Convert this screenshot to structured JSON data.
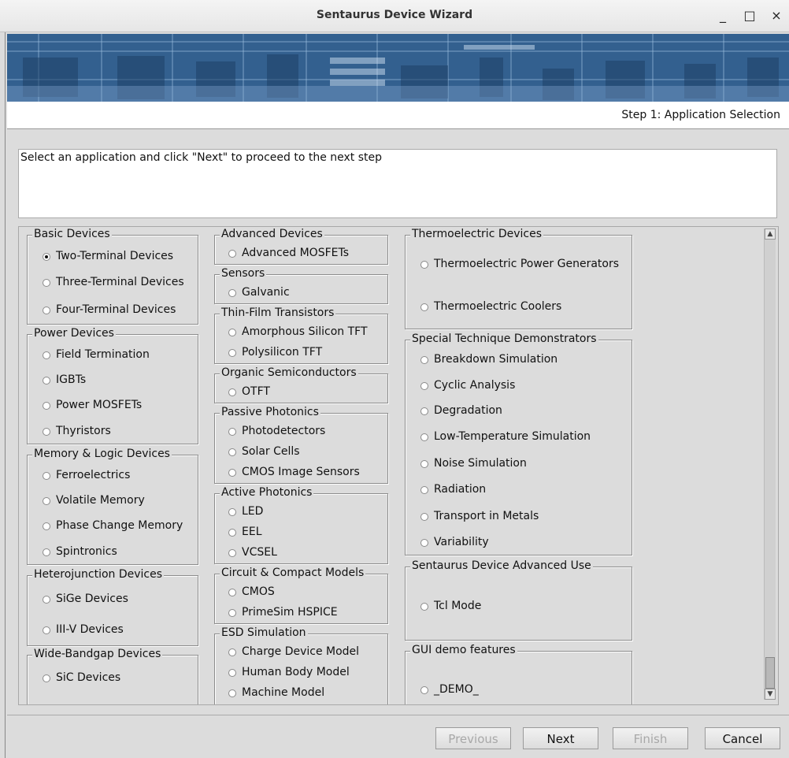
{
  "window": {
    "title": "Sentaurus Device Wizard",
    "minimize": "_",
    "maximize": "□",
    "close": "×"
  },
  "step_label": "Step 1: Application Selection",
  "instruction": "Select an application and click \"Next\" to proceed to the next step",
  "groups": {
    "basic": {
      "title": "Basic Devices",
      "items": [
        "Two-Terminal Devices",
        "Three-Terminal Devices",
        "Four-Terminal Devices"
      ]
    },
    "power": {
      "title": "Power Devices",
      "items": [
        "Field Termination",
        "IGBTs",
        "Power MOSFETs",
        "Thyristors"
      ]
    },
    "memory": {
      "title": "Memory & Logic Devices",
      "items": [
        "Ferroelectrics",
        "Volatile Memory",
        "Phase Change Memory",
        "Spintronics"
      ]
    },
    "hetero": {
      "title": "Heterojunction Devices",
      "items": [
        "SiGe Devices",
        "III-V Devices"
      ]
    },
    "wide": {
      "title": "Wide-Bandgap Devices",
      "items": [
        "SiC Devices"
      ]
    },
    "advanced": {
      "title": "Advanced Devices",
      "items": [
        "Advanced MOSFETs"
      ]
    },
    "sensors": {
      "title": "Sensors",
      "items": [
        "Galvanic"
      ]
    },
    "tft": {
      "title": "Thin-Film Transistors",
      "items": [
        "Amorphous Silicon TFT",
        "Polysilicon TFT"
      ]
    },
    "organic": {
      "title": "Organic Semiconductors",
      "items": [
        "OTFT"
      ]
    },
    "passive": {
      "title": "Passive Photonics",
      "items": [
        "Photodetectors",
        "Solar Cells",
        "CMOS Image Sensors"
      ]
    },
    "active": {
      "title": "Active Photonics",
      "items": [
        "LED",
        "EEL",
        "VCSEL"
      ]
    },
    "circuit": {
      "title": "Circuit & Compact Models",
      "items": [
        "CMOS",
        "PrimeSim HSPICE"
      ]
    },
    "esd": {
      "title": "ESD Simulation",
      "items": [
        "Charge Device Model",
        "Human Body Model",
        "Machine Model"
      ]
    },
    "thermo": {
      "title": "Thermoelectric Devices",
      "items": [
        "Thermoelectric Power Generators",
        "Thermoelectric Coolers"
      ]
    },
    "special": {
      "title": "Special Technique Demonstrators",
      "items": [
        "Breakdown Simulation",
        "Cyclic Analysis",
        "Degradation",
        "Low-Temperature Simulation",
        "Noise Simulation",
        "Radiation",
        "Transport in Metals",
        "Variability"
      ]
    },
    "sdadv": {
      "title": "Sentaurus Device Advanced Use",
      "items": [
        "Tcl Mode"
      ]
    },
    "gui": {
      "title": "GUI demo features",
      "items": [
        "_DEMO_"
      ]
    }
  },
  "selected": "Two-Terminal Devices",
  "buttons": {
    "previous": "Previous",
    "next": "Next",
    "finish": "Finish",
    "cancel": "Cancel"
  }
}
